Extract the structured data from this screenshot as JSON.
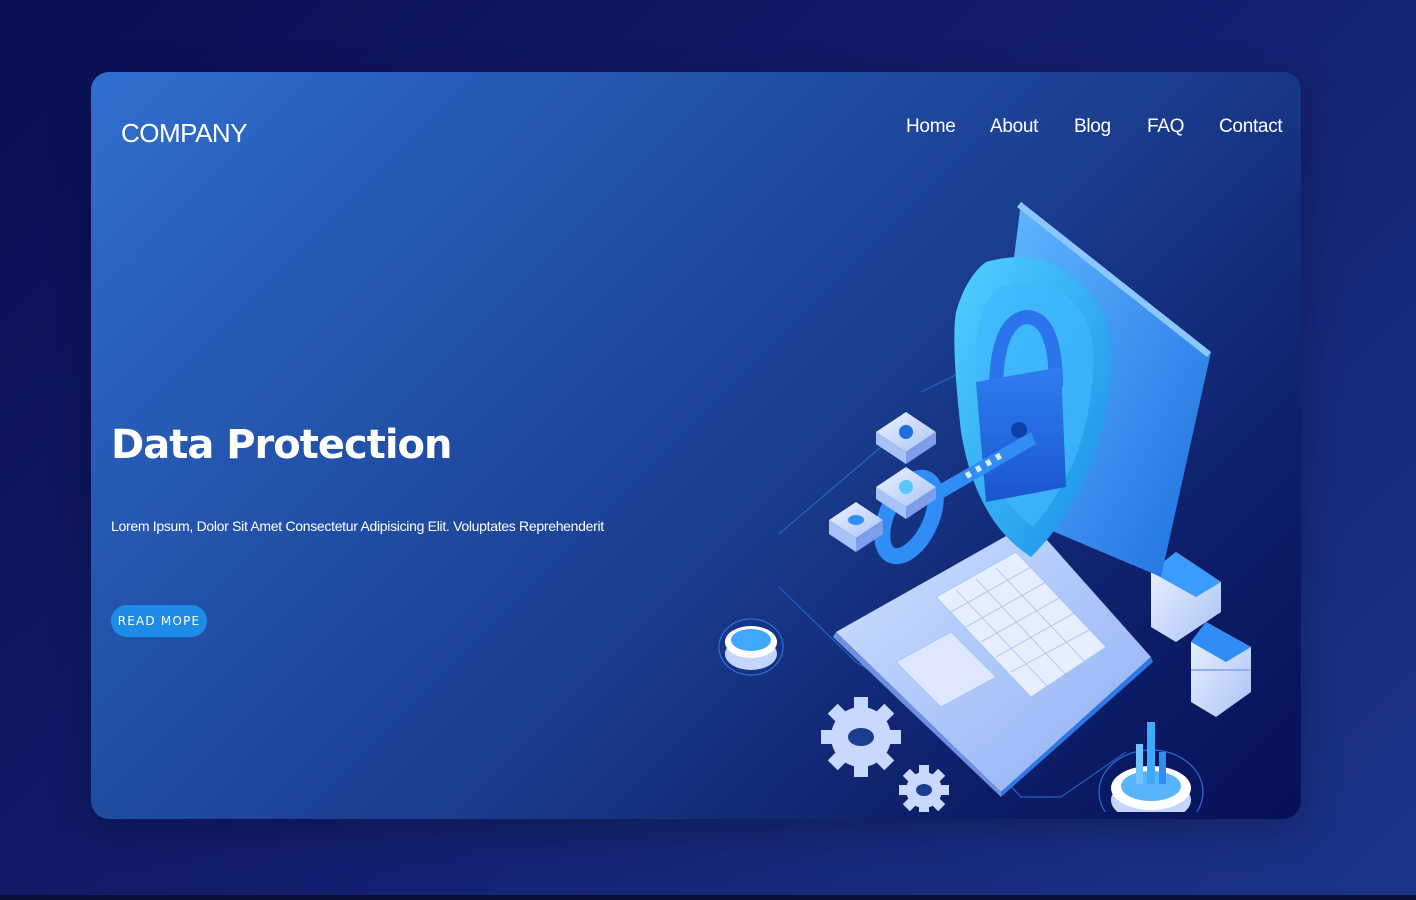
{
  "brand": {
    "name": "COMPANY"
  },
  "nav": {
    "items": [
      "Home",
      "About",
      "Blog",
      "FAQ",
      "Contact"
    ]
  },
  "hero": {
    "title": "Data Protection",
    "text": "Lorem Ipsum, Dolor Sit Amet Consectetur Adipisicing Elit. Voluptates Reprehenderit",
    "cta_label": "READ MOPE"
  },
  "illustration": {
    "icons": [
      "laptop-icon",
      "shield-icon",
      "padlock-icon",
      "key-icon",
      "gear-icon",
      "server-icon",
      "database-icon",
      "chart-icon"
    ]
  },
  "colors": {
    "accent": "#1e8ce6",
    "background": "#0a0f55",
    "card_start": "#2f6fd0",
    "card_end": "#08105a"
  }
}
